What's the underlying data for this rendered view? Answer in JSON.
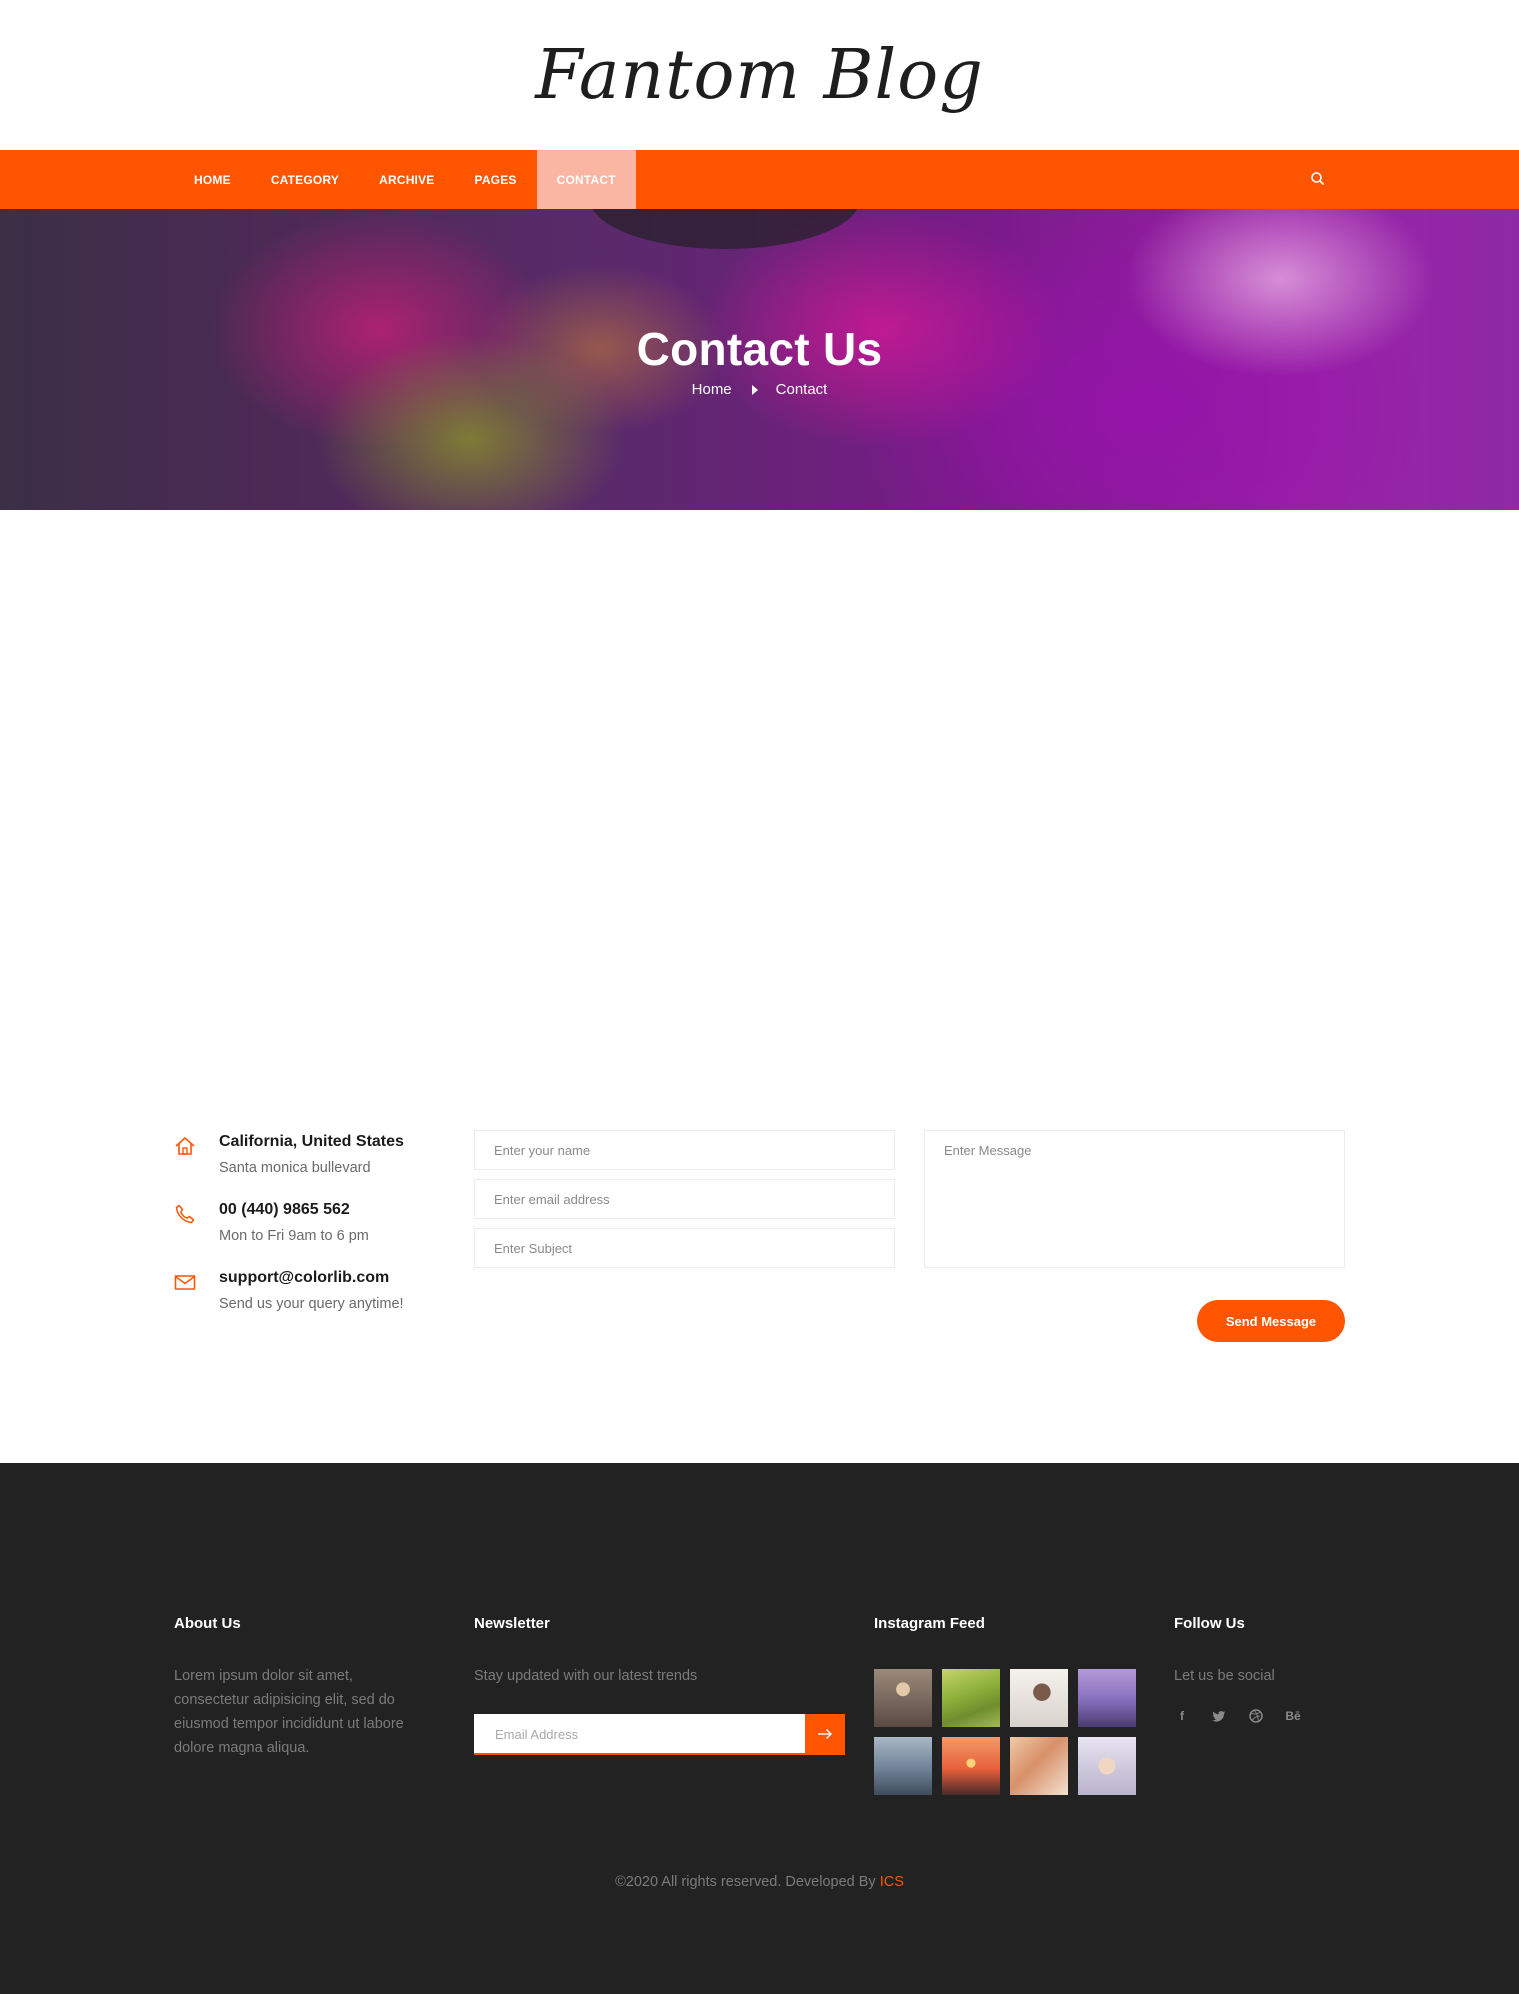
{
  "site": {
    "logo": "Fantom Blog"
  },
  "nav": {
    "items": [
      {
        "label": "HOME"
      },
      {
        "label": "CATEGORY"
      },
      {
        "label": "ARCHIVE"
      },
      {
        "label": "PAGES"
      },
      {
        "label": "CONTACT",
        "active": true
      }
    ],
    "search_icon": "search-icon",
    "bg_color": "#ff5500",
    "active_bg_color": "#fbb6a3"
  },
  "hero": {
    "title": "Contact Us",
    "breadcrumb": [
      "Home",
      "Contact"
    ]
  },
  "contact_info": [
    {
      "icon": "home-icon",
      "title": "California, United States",
      "subtitle": "Santa monica bullevard"
    },
    {
      "icon": "phone-icon",
      "title": "00 (440) 9865 562",
      "subtitle": "Mon to Fri 9am to 6 pm"
    },
    {
      "icon": "mail-icon",
      "title": "support@colorlib.com",
      "subtitle": "Send us your query anytime!"
    }
  ],
  "form": {
    "name_placeholder": "Enter your name",
    "email_placeholder": "Enter email address",
    "subject_placeholder": "Enter Subject",
    "message_placeholder": "Enter Message",
    "submit_label": "Send Message"
  },
  "footer": {
    "about": {
      "heading": "About Us",
      "text": "Lorem ipsum dolor sit amet, consectetur adipisicing elit, sed do eiusmod tempor incididunt ut labore dolore magna aliqua."
    },
    "newsletter": {
      "heading": "Newsletter",
      "text": "Stay updated with our latest trends",
      "email_placeholder": "Email Address",
      "submit_icon": "arrow-right-icon"
    },
    "instagram": {
      "heading": "Instagram Feed",
      "images": [
        "instagram-photo-1",
        "instagram-photo-2",
        "instagram-photo-3",
        "instagram-photo-4",
        "instagram-photo-5",
        "instagram-photo-6",
        "instagram-photo-7",
        "instagram-photo-8"
      ]
    },
    "follow": {
      "heading": "Follow Us",
      "text": "Let us be social",
      "social": [
        {
          "icon": "facebook-icon",
          "glyph": "f"
        },
        {
          "icon": "twitter-icon",
          "glyph": ""
        },
        {
          "icon": "dribbble-icon",
          "glyph": ""
        },
        {
          "icon": "behance-icon",
          "glyph": "Bē"
        }
      ]
    },
    "copyright": {
      "text": "©2020 All rights reserved. Developed By ",
      "link": "ICS"
    }
  },
  "colors": {
    "accent": "#ff5500",
    "footer_bg": "#222222"
  }
}
